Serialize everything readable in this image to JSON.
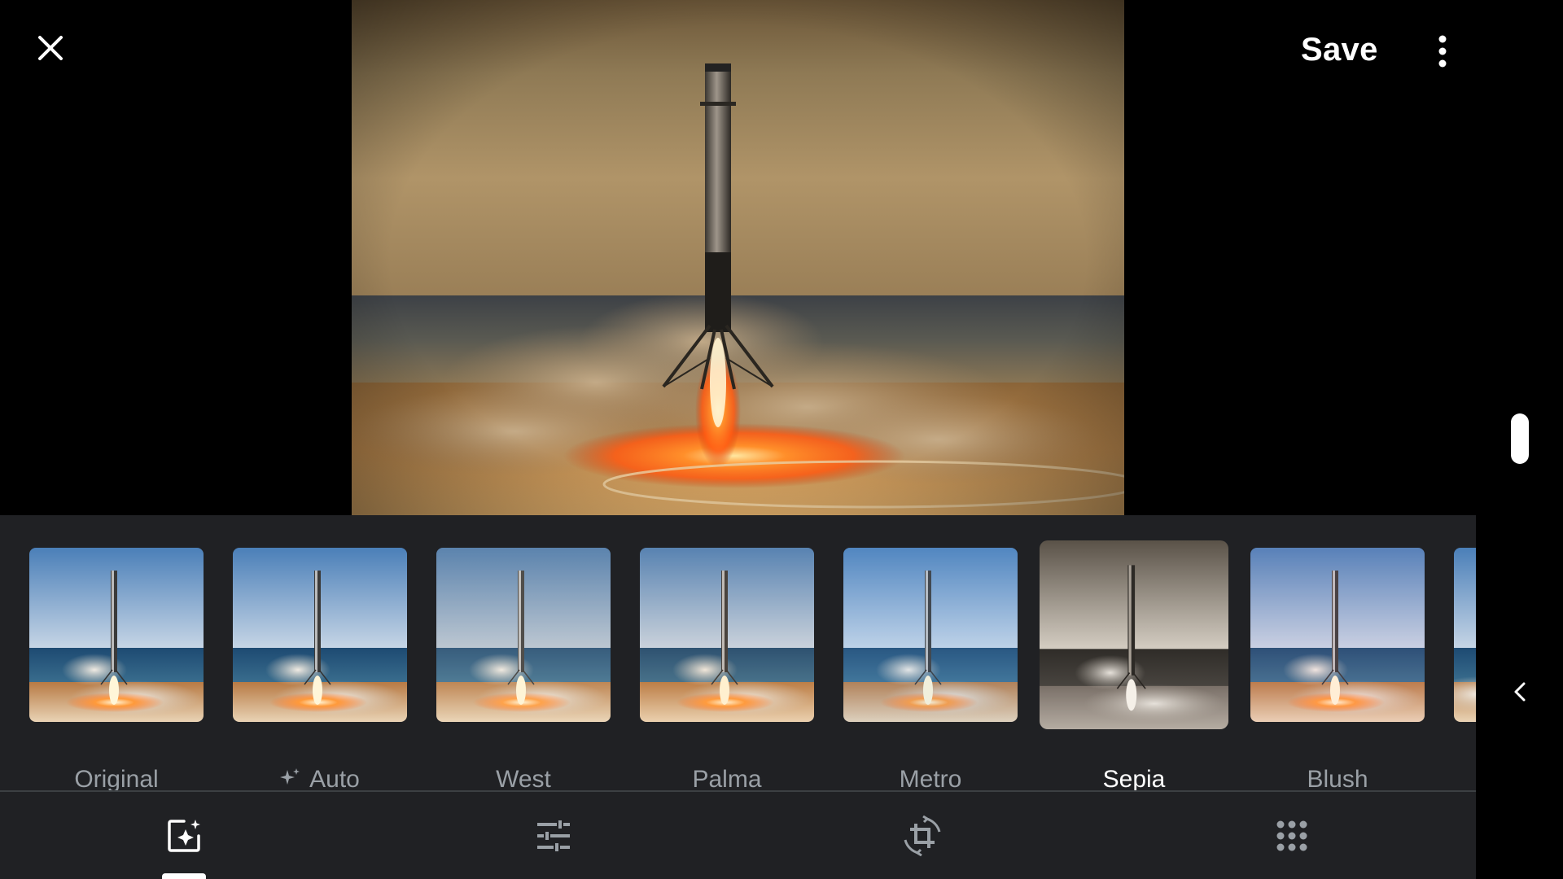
{
  "toolbar": {
    "save_label": "Save"
  },
  "filters": [
    {
      "label": "Original",
      "tone": "color"
    },
    {
      "label": "Auto",
      "tone": "color",
      "icon": "sparkle-icon"
    },
    {
      "label": "West",
      "tone": "color"
    },
    {
      "label": "Palma",
      "tone": "color"
    },
    {
      "label": "Metro",
      "tone": "color"
    },
    {
      "label": "Sepia",
      "tone": "sepia",
      "selected": true
    },
    {
      "label": "Blush",
      "tone": "color"
    }
  ],
  "tools": [
    {
      "name": "suggestions",
      "icon": "suggestions-icon",
      "active": true
    },
    {
      "name": "adjust",
      "icon": "adjust-sliders-icon"
    },
    {
      "name": "crop",
      "icon": "crop-rotate-icon"
    },
    {
      "name": "more-tools",
      "icon": "grid-dots-icon"
    }
  ],
  "colors": {
    "panel_bg": "#202124",
    "label_inactive": "#9aa0a6",
    "label_active": "#ffffff"
  }
}
